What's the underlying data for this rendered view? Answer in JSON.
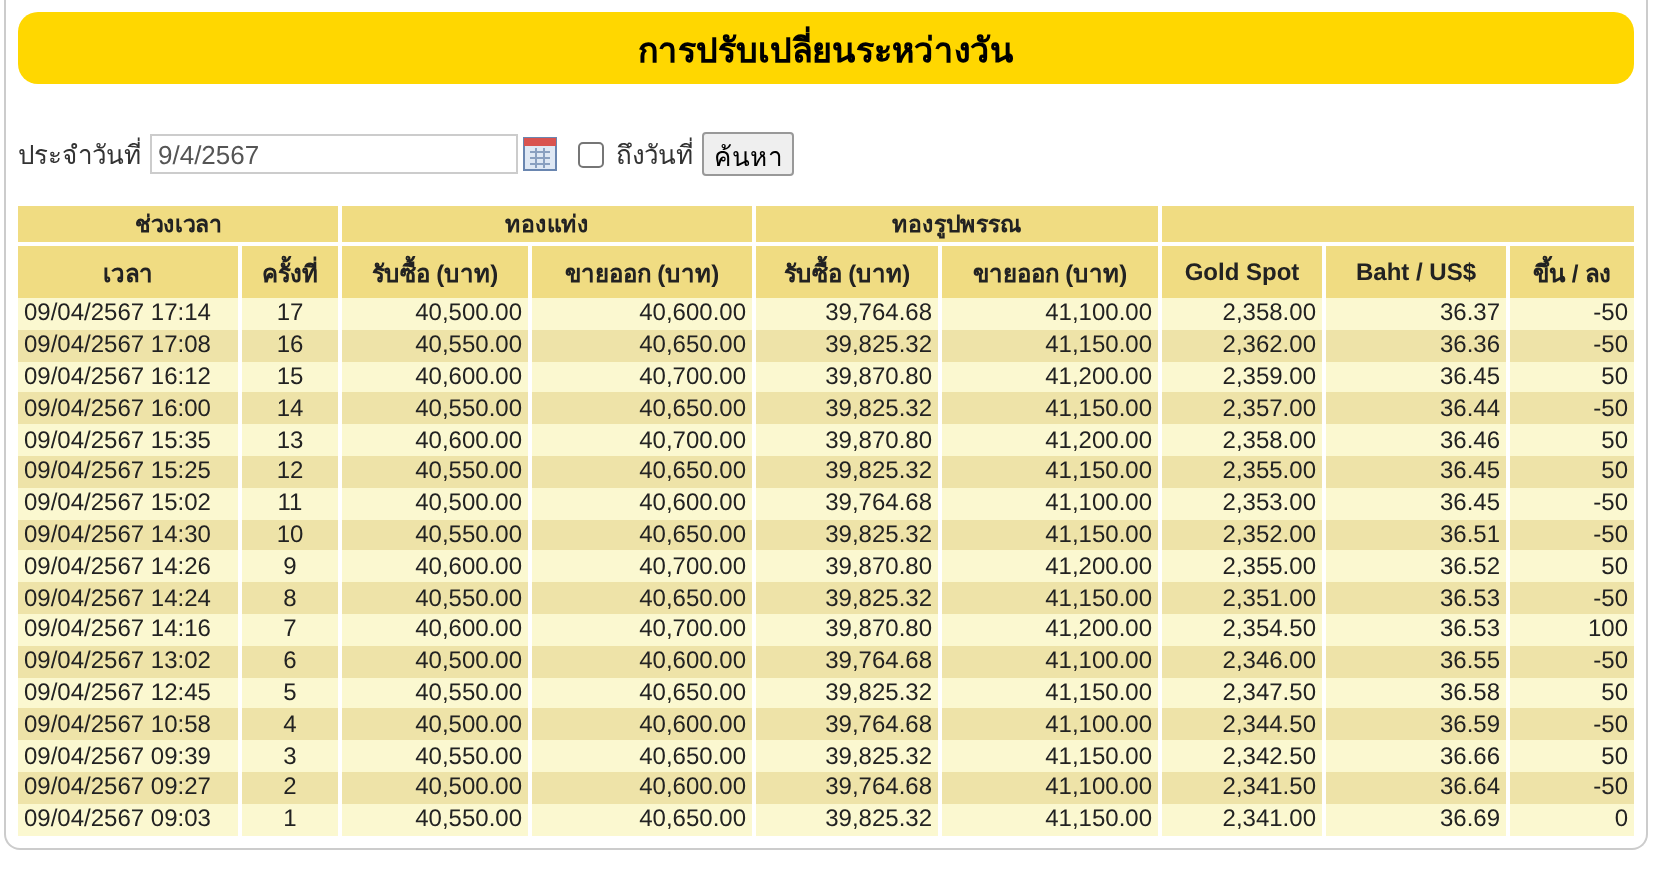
{
  "title": "การปรับเปลี่ยนระหว่างวัน",
  "form": {
    "date_label": "ประจำวันที่",
    "date_value": "9/4/2567",
    "to_date": {
      "label": "ถึงวันที่",
      "checked": false
    },
    "search_button": "ค้นหา"
  },
  "table": {
    "groups": [
      "ช่วงเวลา",
      "ทองแท่ง",
      "ทองรูปพรรณ"
    ],
    "columns": [
      "เวลา",
      "ครั้งที่",
      "รับซื้อ (บาท)",
      "ขายออก (บาท)",
      "รับซื้อ (บาท)",
      "ขายออก (บาท)",
      "Gold Spot",
      "Baht / US$",
      "ขึ้น / ลง"
    ],
    "rows": [
      [
        "09/04/2567 17:14",
        "17",
        "40,500.00",
        "40,600.00",
        "39,764.68",
        "41,100.00",
        "2,358.00",
        "36.37",
        "-50"
      ],
      [
        "09/04/2567 17:08",
        "16",
        "40,550.00",
        "40,650.00",
        "39,825.32",
        "41,150.00",
        "2,362.00",
        "36.36",
        "-50"
      ],
      [
        "09/04/2567 16:12",
        "15",
        "40,600.00",
        "40,700.00",
        "39,870.80",
        "41,200.00",
        "2,359.00",
        "36.45",
        "50"
      ],
      [
        "09/04/2567 16:00",
        "14",
        "40,550.00",
        "40,650.00",
        "39,825.32",
        "41,150.00",
        "2,357.00",
        "36.44",
        "-50"
      ],
      [
        "09/04/2567 15:35",
        "13",
        "40,600.00",
        "40,700.00",
        "39,870.80",
        "41,200.00",
        "2,358.00",
        "36.46",
        "50"
      ],
      [
        "09/04/2567 15:25",
        "12",
        "40,550.00",
        "40,650.00",
        "39,825.32",
        "41,150.00",
        "2,355.00",
        "36.45",
        "50"
      ],
      [
        "09/04/2567 15:02",
        "11",
        "40,500.00",
        "40,600.00",
        "39,764.68",
        "41,100.00",
        "2,353.00",
        "36.45",
        "-50"
      ],
      [
        "09/04/2567 14:30",
        "10",
        "40,550.00",
        "40,650.00",
        "39,825.32",
        "41,150.00",
        "2,352.00",
        "36.51",
        "-50"
      ],
      [
        "09/04/2567 14:26",
        "9",
        "40,600.00",
        "40,700.00",
        "39,870.80",
        "41,200.00",
        "2,355.00",
        "36.52",
        "50"
      ],
      [
        "09/04/2567 14:24",
        "8",
        "40,550.00",
        "40,650.00",
        "39,825.32",
        "41,150.00",
        "2,351.00",
        "36.53",
        "-50"
      ],
      [
        "09/04/2567 14:16",
        "7",
        "40,600.00",
        "40,700.00",
        "39,870.80",
        "41,200.00",
        "2,354.50",
        "36.53",
        "100"
      ],
      [
        "09/04/2567 13:02",
        "6",
        "40,500.00",
        "40,600.00",
        "39,764.68",
        "41,100.00",
        "2,346.00",
        "36.55",
        "-50"
      ],
      [
        "09/04/2567 12:45",
        "5",
        "40,550.00",
        "40,650.00",
        "39,825.32",
        "41,150.00",
        "2,347.50",
        "36.58",
        "50"
      ],
      [
        "09/04/2567 10:58",
        "4",
        "40,500.00",
        "40,600.00",
        "39,764.68",
        "41,100.00",
        "2,344.50",
        "36.59",
        "-50"
      ],
      [
        "09/04/2567 09:39",
        "3",
        "40,550.00",
        "40,650.00",
        "39,825.32",
        "41,150.00",
        "2,342.50",
        "36.66",
        "50"
      ],
      [
        "09/04/2567 09:27",
        "2",
        "40,500.00",
        "40,600.00",
        "39,764.68",
        "41,100.00",
        "2,341.50",
        "36.64",
        "-50"
      ],
      [
        "09/04/2567 09:03",
        "1",
        "40,550.00",
        "40,650.00",
        "39,825.32",
        "41,150.00",
        "2,341.00",
        "36.69",
        "0"
      ]
    ]
  }
}
